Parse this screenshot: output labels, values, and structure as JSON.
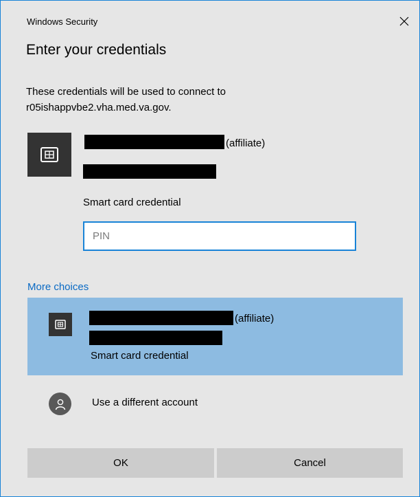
{
  "window": {
    "title": "Windows Security",
    "close_icon": "close-icon"
  },
  "heading": "Enter your credentials",
  "description": {
    "line1": "These credentials will be used to connect to",
    "line2": "r05ishappvbe2.vha.med.va.gov."
  },
  "primary_credential": {
    "icon": "smart-card-icon",
    "affiliation": "(affiliate)",
    "type": "Smart card credential"
  },
  "pin_field": {
    "placeholder": "PIN",
    "value": ""
  },
  "more_choices": {
    "label": "More choices",
    "items": [
      {
        "icon": "smart-card-icon",
        "affiliation": "(affiliate)",
        "type": "Smart card credential",
        "selected": true
      }
    ],
    "different_account": {
      "icon": "user-icon",
      "label": "Use a different account"
    }
  },
  "buttons": {
    "ok": "OK",
    "cancel": "Cancel"
  },
  "colors": {
    "background": "#e6e6e6",
    "accent": "#1883d7",
    "link": "#0a6ac4",
    "selection": "#8dbbe1",
    "button": "#cccccc",
    "tile": "#333333"
  }
}
